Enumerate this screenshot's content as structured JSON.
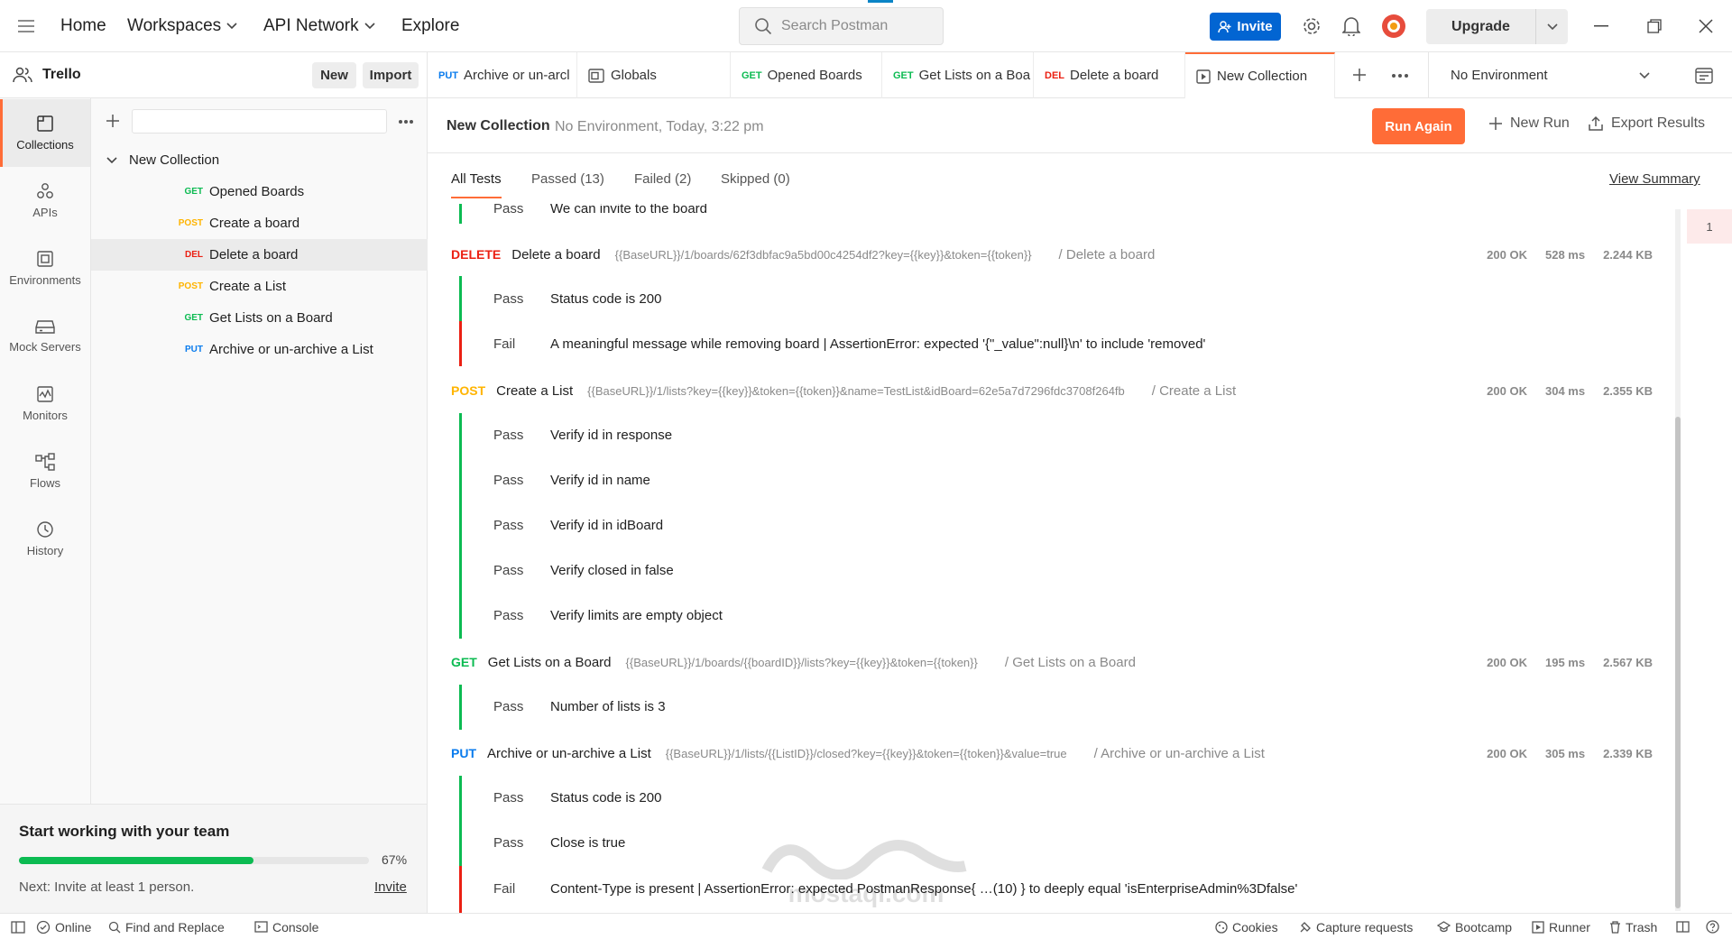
{
  "topbar": {
    "nav": [
      "Home",
      "Workspaces",
      "API Network",
      "Explore"
    ],
    "search_placeholder": "Search Postman",
    "invite_label": "Invite",
    "upgrade_label": "Upgrade"
  },
  "workspace": {
    "name": "Trello",
    "new_label": "New",
    "import_label": "Import"
  },
  "tabs": [
    {
      "method": "PUT",
      "label": "Archive or un-arcl"
    },
    {
      "method": "",
      "label": "Globals"
    },
    {
      "method": "GET",
      "label": "Opened Boards"
    },
    {
      "method": "GET",
      "label": "Get Lists on a Boa"
    },
    {
      "method": "DEL",
      "label": "Delete a board"
    },
    {
      "method": "",
      "label": "New Collection"
    }
  ],
  "environment": {
    "selected": "No Environment"
  },
  "rail": [
    {
      "label": "Collections"
    },
    {
      "label": "APIs"
    },
    {
      "label": "Environments"
    },
    {
      "label": "Mock Servers"
    },
    {
      "label": "Monitors"
    },
    {
      "label": "Flows"
    },
    {
      "label": "History"
    }
  ],
  "tree": {
    "collection": "New Collection",
    "items": [
      {
        "method": "GET",
        "label": "Opened Boards"
      },
      {
        "method": "POST",
        "label": "Create a board"
      },
      {
        "method": "DEL",
        "label": "Delete a board"
      },
      {
        "method": "POST",
        "label": "Create a List"
      },
      {
        "method": "GET",
        "label": "Get Lists on a Board"
      },
      {
        "method": "PUT",
        "label": "Archive or un-archive a List"
      }
    ]
  },
  "team_card": {
    "title": "Start working with your team",
    "progress": 67,
    "progress_label": "67%",
    "next_text": "Next: Invite at least 1 person.",
    "invite_link": "Invite"
  },
  "run": {
    "title": "New Collection",
    "meta": "No Environment, Today, 3:22 pm",
    "run_again": "Run Again",
    "new_run": "New Run",
    "export": "Export Results",
    "filters": [
      "All Tests",
      "Passed (13)",
      "Failed (2)",
      "Skipped (0)"
    ],
    "view_summary": "View Summary",
    "cut_row": {
      "status": "Pass",
      "text": "We can invite to the board"
    },
    "requests": [
      {
        "method": "DELETE",
        "name": "Delete a board",
        "url": "{{BaseURL}}/1/boards/62f3dbfac9a5bd00c4254df2?key={{key}}&token={{token}}",
        "path": "/ Delete a board",
        "status": "200 OK",
        "time": "528 ms",
        "size": "2.244 KB",
        "tests": [
          {
            "status": "Pass",
            "text": "Status code is 200"
          },
          {
            "status": "Fail",
            "text": "A meaningful message while removing board | AssertionError: expected '{\"_value\":null}\\n' to include 'removed'"
          }
        ]
      },
      {
        "method": "POST",
        "name": "Create a List",
        "url": "{{BaseURL}}/1/lists?key={{key}}&token={{token}}&name=TestList&idBoard=62e5a7d7296fdc3708f264fb",
        "path": "/ Create a List",
        "status": "200 OK",
        "time": "304 ms",
        "size": "2.355 KB",
        "tests": [
          {
            "status": "Pass",
            "text": "Verify id in response"
          },
          {
            "status": "Pass",
            "text": "Verify id in name"
          },
          {
            "status": "Pass",
            "text": "Verify id in idBoard"
          },
          {
            "status": "Pass",
            "text": "Verify closed in false"
          },
          {
            "status": "Pass",
            "text": "Verify limits are empty object"
          }
        ]
      },
      {
        "method": "GET",
        "name": "Get Lists on a Board",
        "url": "{{BaseURL}}/1/boards/{{boardID}}/lists?key={{key}}&token={{token}}",
        "path": "/ Get Lists on a Board",
        "status": "200 OK",
        "time": "195 ms",
        "size": "2.567 KB",
        "tests": [
          {
            "status": "Pass",
            "text": "Number of lists is 3"
          }
        ]
      },
      {
        "method": "PUT",
        "name": "Archive or un-archive a List",
        "url": "{{BaseURL}}/1/lists/{{ListID}}/closed?key={{key}}&token={{token}}&value=true",
        "path": "/ Archive or un-archive a List",
        "status": "200 OK",
        "time": "305 ms",
        "size": "2.339 KB",
        "tests": [
          {
            "status": "Pass",
            "text": "Status code is 200"
          },
          {
            "status": "Pass",
            "text": "Close is true"
          },
          {
            "status": "Fail",
            "text": "Content-Type is present | AssertionError: expected PostmanResponse{ …(10) } to deeply equal 'isEnterpriseAdmin%3Dfalse'"
          }
        ]
      }
    ],
    "minimap_label": "1"
  },
  "statusbar": {
    "online": "Online",
    "find_replace": "Find and Replace",
    "console": "Console",
    "cookies": "Cookies",
    "capture": "Capture requests",
    "bootcamp": "Bootcamp",
    "runner": "Runner",
    "trash": "Trash"
  },
  "watermark": {
    "text": "mostaql.com"
  },
  "colors": {
    "accent": "#ff6c37",
    "invite_blue": "#0265d2",
    "get": "#0cbb52",
    "post": "#ffb400",
    "put": "#097bed",
    "delete": "#eb2013",
    "pass_bar": "#0cbb52",
    "fail_bar": "#eb2013"
  }
}
